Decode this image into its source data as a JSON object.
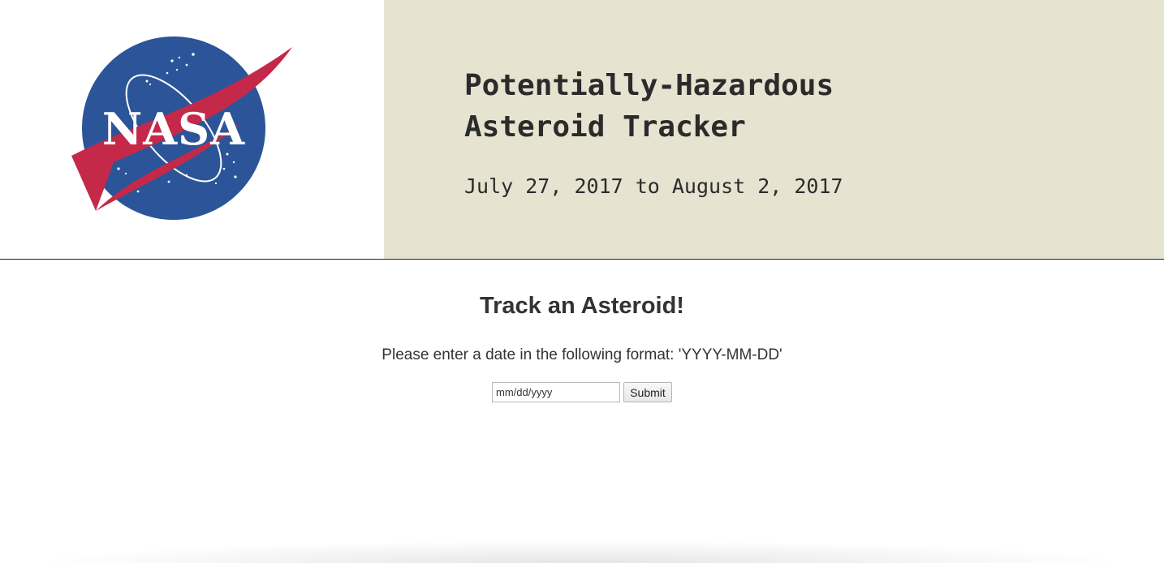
{
  "header": {
    "logo_text": "NASA",
    "title": "Potentially-Hazardous Asteroid Tracker",
    "date_range": "July 27, 2017 to August 2, 2017",
    "title_bg_color": "#e7e3d1"
  },
  "main": {
    "heading": "Track an Asteroid!",
    "instructions": "Please enter a date in the following format: 'YYYY-MM-DD'",
    "date_input": {
      "placeholder": "mm/dd/yyyy",
      "value": ""
    },
    "submit_label": "Submit"
  },
  "colors": {
    "nasa_blue": "#2b5598",
    "nasa_red": "#c4294a"
  }
}
